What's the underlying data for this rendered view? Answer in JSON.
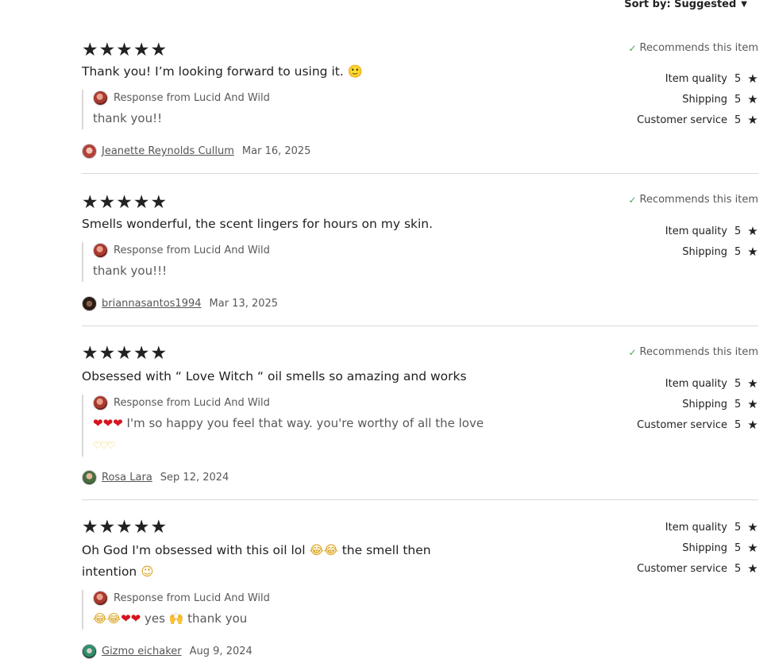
{
  "sort": {
    "label": "Sort by: Suggested"
  },
  "shop_name": "Lucid And Wild",
  "reviews": [
    {
      "stars": 5,
      "text": "Thank you! I’m looking forward to using it. 🙂",
      "recommends": "Recommends this item",
      "response_label": "Response from Lucid And Wild",
      "response_text": "thank you!!",
      "reviewer": "Jeanette Reynolds Cullum",
      "date": "Mar 16, 2025",
      "ratings": [
        {
          "label": "Item quality",
          "value": "5"
        },
        {
          "label": "Shipping",
          "value": "5"
        },
        {
          "label": "Customer service",
          "value": "5"
        }
      ]
    },
    {
      "stars": 5,
      "text": "Smells wonderful, the scent lingers for hours on my skin.",
      "recommends": "Recommends this item",
      "response_label": "Response from Lucid And Wild",
      "response_text": "thank you!!!",
      "reviewer": "briannasantos1994",
      "date": "Mar 13, 2025",
      "ratings": [
        {
          "label": "Item quality",
          "value": "5"
        },
        {
          "label": "Shipping",
          "value": "5"
        }
      ]
    },
    {
      "stars": 5,
      "text": "Obsessed with “ Love Witch “ oil smells so amazing and works",
      "recommends": "Recommends this item",
      "response_label": "Response from Lucid And Wild",
      "response_text_main": "I'm so happy you feel that way. you're worthy of all the love",
      "reviewer": "Rosa Lara",
      "date": "Sep 12, 2024",
      "ratings": [
        {
          "label": "Item quality",
          "value": "5"
        },
        {
          "label": "Shipping",
          "value": "5"
        },
        {
          "label": "Customer service",
          "value": "5"
        }
      ]
    },
    {
      "stars": 5,
      "text_part1": "Oh God I'm obsessed with this oil lol",
      "text_part2": "the smell then intention",
      "response_label": "Response from Lucid And Wild",
      "response_yes": "yes",
      "response_thanks": "thank you",
      "reviewer": "Gizmo eichaker",
      "date": "Aug 9, 2024",
      "ratings": [
        {
          "label": "Item quality",
          "value": "5"
        },
        {
          "label": "Shipping",
          "value": "5"
        },
        {
          "label": "Customer service",
          "value": "5"
        }
      ]
    }
  ],
  "icons": {
    "star": "star-icon",
    "check": "check-icon",
    "dropdown": "caret-down-icon"
  },
  "colors": {
    "text": "#222222",
    "muted": "#595959",
    "check": "#4aa564",
    "heart": "#d6141f",
    "divider": "#d8d8d8"
  }
}
